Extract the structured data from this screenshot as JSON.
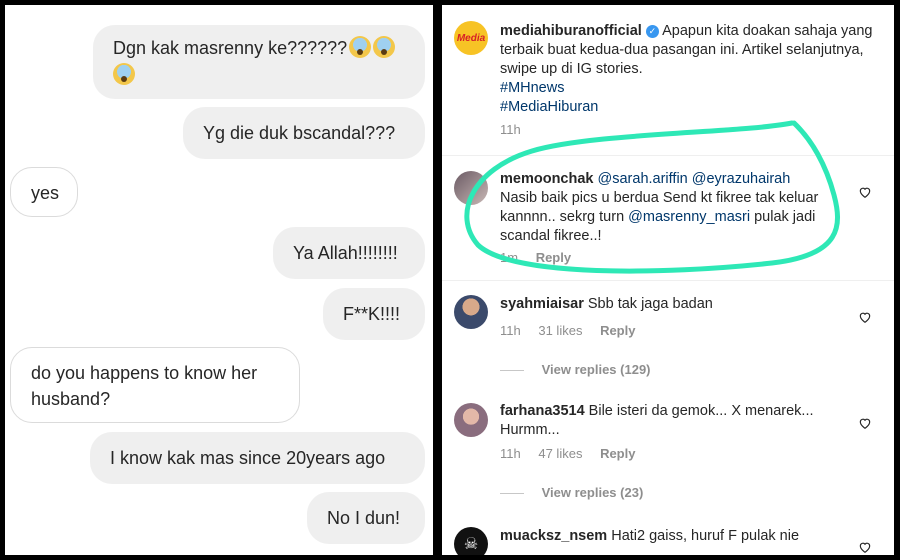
{
  "chat": {
    "messages": [
      {
        "text": "Dgn kak masrenny ke??????",
        "from": "me"
      },
      {
        "text": "Yg die duk bscandal???",
        "from": "me"
      },
      {
        "text": "yes",
        "from": "them"
      },
      {
        "text": "Ya Allah!!!!!!!!",
        "from": "me"
      },
      {
        "text": "F**K!!!!",
        "from": "me"
      },
      {
        "text": "do you happens to know her husband?",
        "from": "them"
      },
      {
        "text": "I know kak mas since 20years ago",
        "from": "me"
      },
      {
        "text": "No I dun!",
        "from": "me"
      }
    ],
    "emoji_name": "face-screaming-in-fear-icon"
  },
  "post": {
    "username": "mediahiburanofficial",
    "avatar_text": "Media",
    "caption": "Apapun kita doakan sahaja yang terbaik buat kedua-dua pasangan ini. Artikel selanjutnya, swipe up di IG stories.",
    "hashtags": [
      "#MHnews",
      "#MediaHiburan"
    ],
    "time": "11h"
  },
  "comments": [
    {
      "username": "memoonchak",
      "mentions": [
        "@sarah.ariffin",
        "@eyrazuhairah"
      ],
      "text_a": "Nasib baik pics u berdua Send kt fikree tak keluar kannnn.. sekrg turn",
      "mention_inline": "@masrenny_masri",
      "text_b": "pulak jadi scandal fikree..!",
      "time": "1m",
      "reply": "Reply",
      "highlight_color": "#2ee8b6"
    },
    {
      "username": "syahmiaisar",
      "text": "Sbb tak jaga badan",
      "time": "11h",
      "likes": "31 likes",
      "reply": "Reply",
      "view_replies": "View replies (129)"
    },
    {
      "username": "farhana3514",
      "text": "Bile isteri da gemok... X menarek... Hurmm...",
      "time": "11h",
      "likes": "47 likes",
      "reply": "Reply",
      "view_replies": "View replies (23)"
    },
    {
      "username": "muacksz_nsem",
      "text": "Hati2 gaiss, huruf F pulak nie"
    }
  ]
}
